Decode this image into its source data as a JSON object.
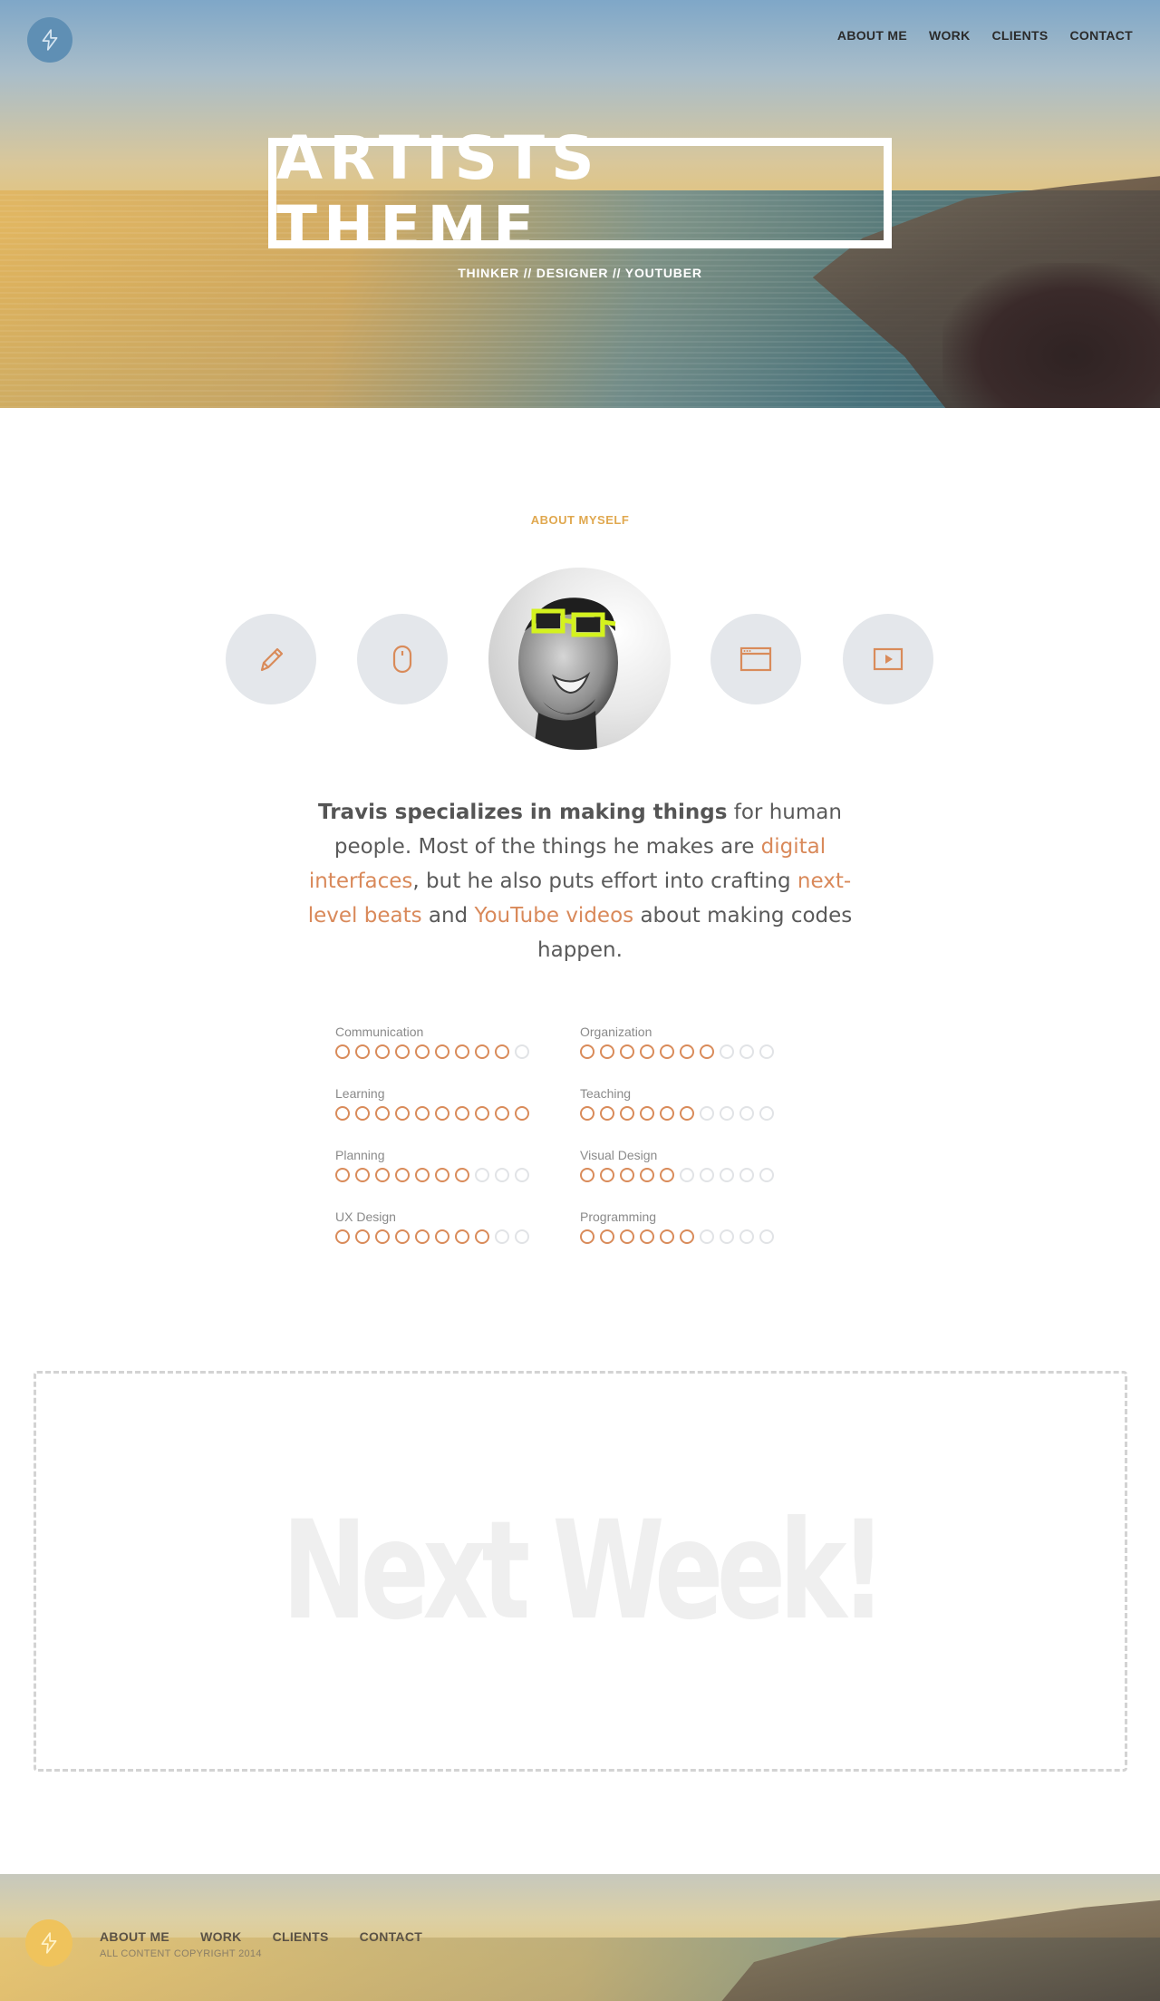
{
  "colors": {
    "accent": "#d98b5a",
    "label": "#e0a84f",
    "icon_bg": "#e4e7eb",
    "logo": "#5f8fb4",
    "footer_logo": "#efc35c"
  },
  "nav": {
    "items": [
      "ABOUT ME",
      "WORK",
      "CLIENTS",
      "CONTACT"
    ]
  },
  "hero": {
    "title": "ARTISTS THEME",
    "subtitle": "THINKER // DESIGNER // YOUTUBER"
  },
  "about": {
    "label": "ABOUT MYSELF",
    "icons": [
      "pencil-icon",
      "mouse-icon",
      "browser-window-icon",
      "video-play-icon"
    ],
    "bio": {
      "strong": "Travis specializes in making things",
      "t1": " for human people. Most of the things he makes are ",
      "link1": "digital interfaces",
      "t2": ", but he also puts effort into crafting ",
      "link2": "next-level beats",
      "t3": " and ",
      "link3": "YouTube videos",
      "t4": " about making codes happen."
    }
  },
  "skills": [
    {
      "name": "Communication",
      "level": 9,
      "max": 10
    },
    {
      "name": "Organization",
      "level": 7,
      "max": 10
    },
    {
      "name": "Learning",
      "level": 10,
      "max": 10
    },
    {
      "name": "Teaching",
      "level": 6,
      "max": 10
    },
    {
      "name": "Planning",
      "level": 7,
      "max": 10
    },
    {
      "name": "Visual Design",
      "level": 5,
      "max": 10
    },
    {
      "name": "UX Design",
      "level": 8,
      "max": 10
    },
    {
      "name": "Programming",
      "level": 6,
      "max": 10
    }
  ],
  "placeholder": {
    "text": "Next Week!"
  },
  "footer": {
    "nav": [
      "ABOUT ME",
      "WORK",
      "CLIENTS",
      "CONTACT"
    ],
    "copyright": "ALL CONTENT COPYRIGHT 2014"
  }
}
